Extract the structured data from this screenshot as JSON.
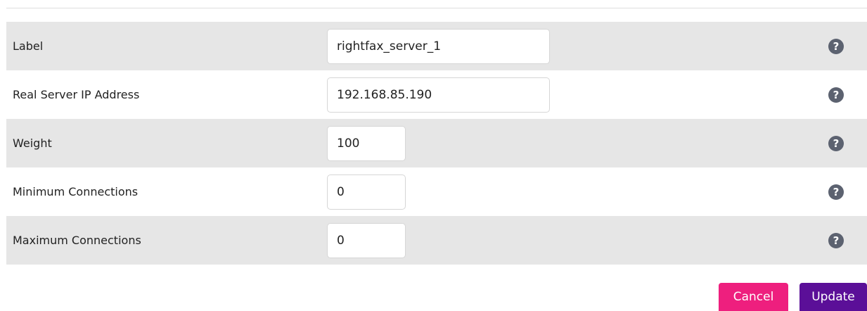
{
  "form": {
    "rows": [
      {
        "label": "Label",
        "value": "rightfax_server_1",
        "help": "?"
      },
      {
        "label": "Real Server IP Address",
        "value": "192.168.85.190",
        "help": "?"
      },
      {
        "label": "Weight",
        "value": "100",
        "help": "?"
      },
      {
        "label": "Minimum Connections",
        "value": "0",
        "help": "?"
      },
      {
        "label": "Maximum Connections",
        "value": "0",
        "help": "?"
      }
    ]
  },
  "actions": {
    "cancel_label": "Cancel",
    "update_label": "Update"
  },
  "colors": {
    "shaded_row": "#e6e6e6",
    "help_icon": "#5c6270",
    "cancel_button": "#ee1f7e",
    "update_button": "#5b0f98"
  },
  "icons": {
    "help": "question-circle-icon"
  }
}
